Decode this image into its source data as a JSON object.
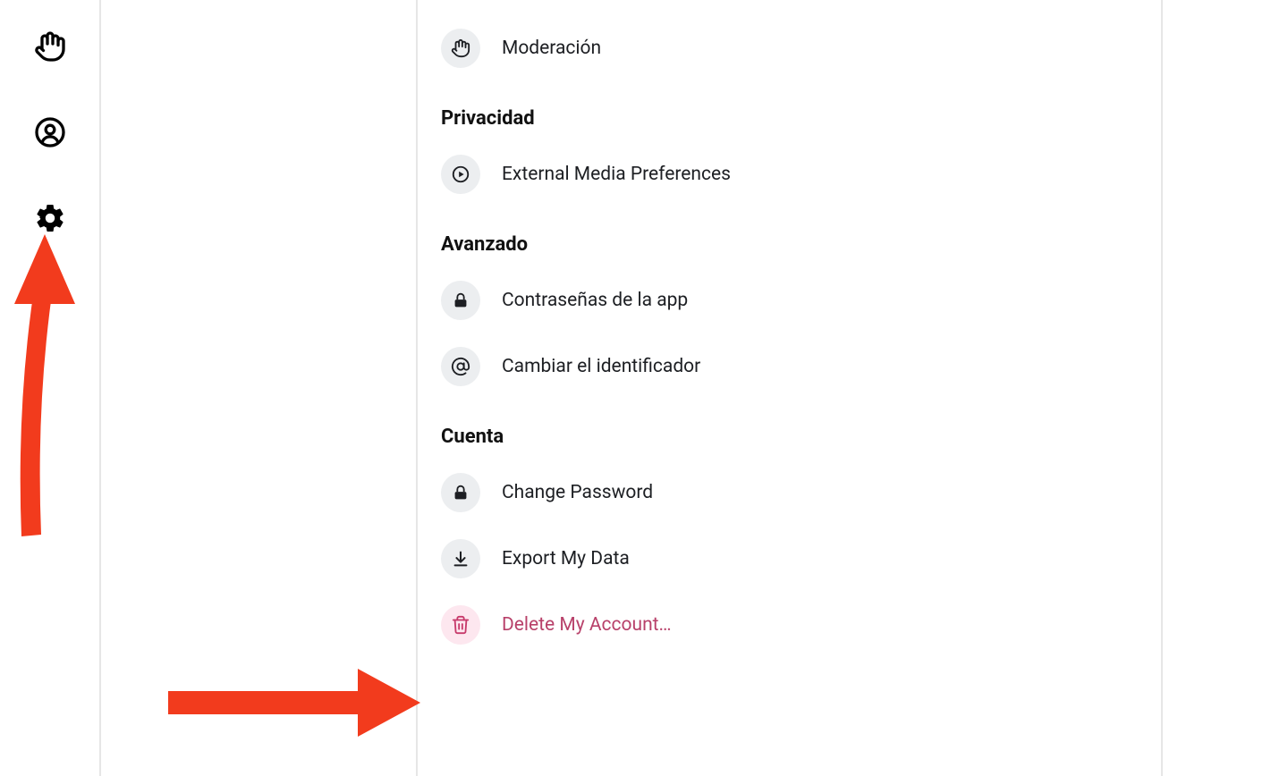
{
  "sidebar": {
    "items": [
      {
        "name": "moderation-icon"
      },
      {
        "name": "profile-icon"
      },
      {
        "name": "settings-icon"
      }
    ]
  },
  "sections": {
    "top": {
      "items": [
        {
          "label": "Moderación",
          "icon": "hand-icon",
          "danger": false
        }
      ]
    },
    "privacy": {
      "title": "Privacidad",
      "items": [
        {
          "label": "External Media Preferences",
          "icon": "play-icon",
          "danger": false
        }
      ]
    },
    "advanced": {
      "title": "Avanzado",
      "items": [
        {
          "label": "Contraseñas de la app",
          "icon": "lock-icon",
          "danger": false
        },
        {
          "label": "Cambiar el identificador",
          "icon": "at-icon",
          "danger": false
        }
      ]
    },
    "account": {
      "title": "Cuenta",
      "items": [
        {
          "label": "Change Password",
          "icon": "lock-icon",
          "danger": false
        },
        {
          "label": "Export My Data",
          "icon": "download-icon",
          "danger": false
        },
        {
          "label": "Delete My Account…",
          "icon": "trash-icon",
          "danger": true
        }
      ]
    }
  },
  "annotations": {
    "arrow_color": "#f23b1d"
  }
}
